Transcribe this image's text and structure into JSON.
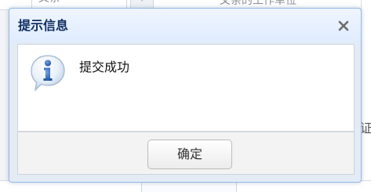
{
  "background": {
    "field_label_top": "父亲",
    "field_label_right": "父亲的工作单位",
    "right_edge_text": "证"
  },
  "dialog": {
    "title": "提示信息",
    "close_glyph": "×",
    "icon": "info-icon",
    "message": "提交成功",
    "ok_label": "确定"
  },
  "colors": {
    "header_title": "#0e2d5f",
    "dialog_border": "#95b8e7",
    "icon_blue": "#2a66b8"
  }
}
